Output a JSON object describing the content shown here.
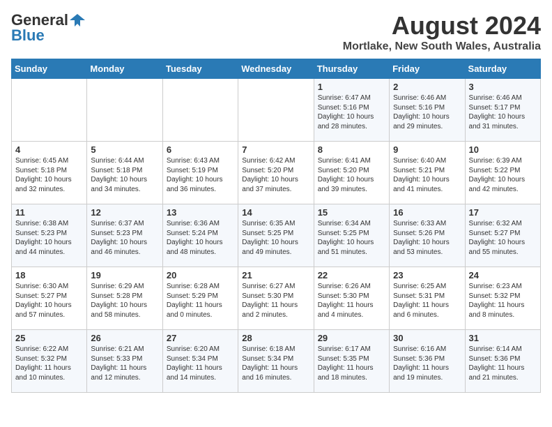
{
  "header": {
    "logo_general": "General",
    "logo_blue": "Blue",
    "month_year": "August 2024",
    "location": "Mortlake, New South Wales, Australia"
  },
  "days_of_week": [
    "Sunday",
    "Monday",
    "Tuesday",
    "Wednesday",
    "Thursday",
    "Friday",
    "Saturday"
  ],
  "weeks": [
    [
      {
        "day": "",
        "info": ""
      },
      {
        "day": "",
        "info": ""
      },
      {
        "day": "",
        "info": ""
      },
      {
        "day": "",
        "info": ""
      },
      {
        "day": "1",
        "info": "Sunrise: 6:47 AM\nSunset: 5:16 PM\nDaylight: 10 hours\nand 28 minutes."
      },
      {
        "day": "2",
        "info": "Sunrise: 6:46 AM\nSunset: 5:16 PM\nDaylight: 10 hours\nand 29 minutes."
      },
      {
        "day": "3",
        "info": "Sunrise: 6:46 AM\nSunset: 5:17 PM\nDaylight: 10 hours\nand 31 minutes."
      }
    ],
    [
      {
        "day": "4",
        "info": "Sunrise: 6:45 AM\nSunset: 5:18 PM\nDaylight: 10 hours\nand 32 minutes."
      },
      {
        "day": "5",
        "info": "Sunrise: 6:44 AM\nSunset: 5:18 PM\nDaylight: 10 hours\nand 34 minutes."
      },
      {
        "day": "6",
        "info": "Sunrise: 6:43 AM\nSunset: 5:19 PM\nDaylight: 10 hours\nand 36 minutes."
      },
      {
        "day": "7",
        "info": "Sunrise: 6:42 AM\nSunset: 5:20 PM\nDaylight: 10 hours\nand 37 minutes."
      },
      {
        "day": "8",
        "info": "Sunrise: 6:41 AM\nSunset: 5:20 PM\nDaylight: 10 hours\nand 39 minutes."
      },
      {
        "day": "9",
        "info": "Sunrise: 6:40 AM\nSunset: 5:21 PM\nDaylight: 10 hours\nand 41 minutes."
      },
      {
        "day": "10",
        "info": "Sunrise: 6:39 AM\nSunset: 5:22 PM\nDaylight: 10 hours\nand 42 minutes."
      }
    ],
    [
      {
        "day": "11",
        "info": "Sunrise: 6:38 AM\nSunset: 5:23 PM\nDaylight: 10 hours\nand 44 minutes."
      },
      {
        "day": "12",
        "info": "Sunrise: 6:37 AM\nSunset: 5:23 PM\nDaylight: 10 hours\nand 46 minutes."
      },
      {
        "day": "13",
        "info": "Sunrise: 6:36 AM\nSunset: 5:24 PM\nDaylight: 10 hours\nand 48 minutes."
      },
      {
        "day": "14",
        "info": "Sunrise: 6:35 AM\nSunset: 5:25 PM\nDaylight: 10 hours\nand 49 minutes."
      },
      {
        "day": "15",
        "info": "Sunrise: 6:34 AM\nSunset: 5:25 PM\nDaylight: 10 hours\nand 51 minutes."
      },
      {
        "day": "16",
        "info": "Sunrise: 6:33 AM\nSunset: 5:26 PM\nDaylight: 10 hours\nand 53 minutes."
      },
      {
        "day": "17",
        "info": "Sunrise: 6:32 AM\nSunset: 5:27 PM\nDaylight: 10 hours\nand 55 minutes."
      }
    ],
    [
      {
        "day": "18",
        "info": "Sunrise: 6:30 AM\nSunset: 5:27 PM\nDaylight: 10 hours\nand 57 minutes."
      },
      {
        "day": "19",
        "info": "Sunrise: 6:29 AM\nSunset: 5:28 PM\nDaylight: 10 hours\nand 58 minutes."
      },
      {
        "day": "20",
        "info": "Sunrise: 6:28 AM\nSunset: 5:29 PM\nDaylight: 11 hours\nand 0 minutes."
      },
      {
        "day": "21",
        "info": "Sunrise: 6:27 AM\nSunset: 5:30 PM\nDaylight: 11 hours\nand 2 minutes."
      },
      {
        "day": "22",
        "info": "Sunrise: 6:26 AM\nSunset: 5:30 PM\nDaylight: 11 hours\nand 4 minutes."
      },
      {
        "day": "23",
        "info": "Sunrise: 6:25 AM\nSunset: 5:31 PM\nDaylight: 11 hours\nand 6 minutes."
      },
      {
        "day": "24",
        "info": "Sunrise: 6:23 AM\nSunset: 5:32 PM\nDaylight: 11 hours\nand 8 minutes."
      }
    ],
    [
      {
        "day": "25",
        "info": "Sunrise: 6:22 AM\nSunset: 5:32 PM\nDaylight: 11 hours\nand 10 minutes."
      },
      {
        "day": "26",
        "info": "Sunrise: 6:21 AM\nSunset: 5:33 PM\nDaylight: 11 hours\nand 12 minutes."
      },
      {
        "day": "27",
        "info": "Sunrise: 6:20 AM\nSunset: 5:34 PM\nDaylight: 11 hours\nand 14 minutes."
      },
      {
        "day": "28",
        "info": "Sunrise: 6:18 AM\nSunset: 5:34 PM\nDaylight: 11 hours\nand 16 minutes."
      },
      {
        "day": "29",
        "info": "Sunrise: 6:17 AM\nSunset: 5:35 PM\nDaylight: 11 hours\nand 18 minutes."
      },
      {
        "day": "30",
        "info": "Sunrise: 6:16 AM\nSunset: 5:36 PM\nDaylight: 11 hours\nand 19 minutes."
      },
      {
        "day": "31",
        "info": "Sunrise: 6:14 AM\nSunset: 5:36 PM\nDaylight: 11 hours\nand 21 minutes."
      }
    ]
  ]
}
